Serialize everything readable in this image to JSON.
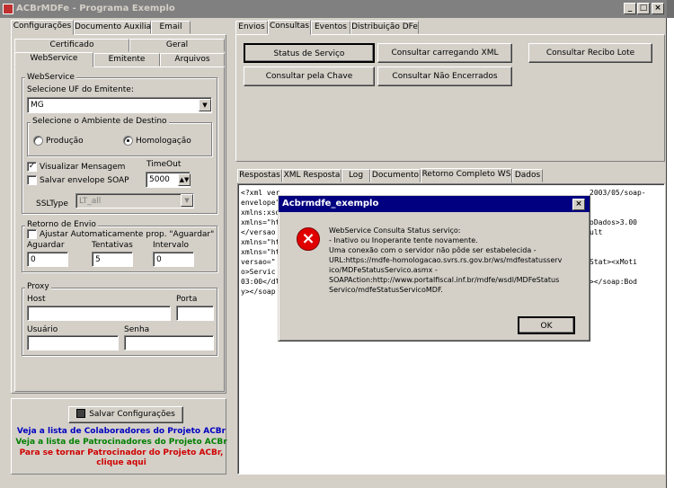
{
  "window": {
    "title": "ACBrMDFe - Programa Exemplo",
    "min_icon": "_",
    "max_icon": "□",
    "close_icon": "×"
  },
  "bg_text": {
    "left": [
      "ct",
      "ga",
      "ra",
      "Fe",
      "Fe",
      "Fe"
    ],
    "right": [
      "Ac",
      "Act",
      "roj",
      "tp",
      "Fe",
      "Fe",
      "ste"
    ]
  },
  "left_tabs": [
    "Configurações",
    "Documento Auxiliar",
    "Email"
  ],
  "sub_tabs_row1": [
    "Certificado",
    "Geral"
  ],
  "sub_tabs_row2": [
    "WebService",
    "Emitente",
    "Arquivos"
  ],
  "webservice": {
    "group_label": "WebService",
    "uf_label": "Selecione UF do Emitente:",
    "uf_value": "MG",
    "ambiente_label": "Selecione o Ambiente de Destino",
    "producao": "Produção",
    "homologacao": "Homologação",
    "visualizar": "Visualizar Mensagem",
    "visualizar_check": "✓",
    "salvar": "Salvar envelope SOAP",
    "timeout_label": "TimeOut",
    "timeout_value": "5000",
    "ssltype_label": "SSLType",
    "ssltype_value": "LT_all"
  },
  "retorno": {
    "group_label": "Retorno de Envio",
    "ajustar": "Ajustar Automaticamente prop. \"Aguardar\"",
    "aguardar_label": "Aguardar",
    "aguardar_value": "0",
    "tentativas_label": "Tentativas",
    "tentativas_value": "5",
    "intervalo_label": "Intervalo",
    "intervalo_value": "0"
  },
  "proxy": {
    "group_label": "Proxy",
    "host": "Host",
    "porta": "Porta",
    "usuario": "Usuário",
    "senha": "Senha"
  },
  "save_button": "Salvar Configurações",
  "links": {
    "colaboradores": "Veja a lista de Colaboradores do Projeto ACBr",
    "patrocinadores": "Veja a lista de Patrocinadores do Projeto ACBr",
    "patrocinador_line1": "Para se tornar Patrocinador do Projeto ACBr,",
    "patrocinador_line2": "clique aqui",
    "colors": {
      "blue": "#0000c0",
      "green": "#008000",
      "red": "#d00000"
    }
  },
  "right_tabs": [
    "Envios",
    "Consultas",
    "Eventos",
    "Distribuição DFe"
  ],
  "consultas_buttons": [
    "Status de Serviço",
    "Consultar carregando XML",
    "Consultar Recibo Lote",
    "Consultar pela Chave",
    "Consultar Não Encerrados"
  ],
  "result_tabs": [
    "Respostas",
    "XML Resposta",
    "Log",
    "Documento",
    "Retorno Completo WS",
    "Dados"
  ],
  "xml_lines": [
    "<?xml ver",
    "envelope\"",
    "xmlns:xsd",
    "xmlns=\"ht",
    "</versao",
    "xmlns=\"ht",
    "xmlns=\"ht",
    "versao=\"",
    "o>Servic",
    "03:00</dl",
    "y></soap"
  ],
  "xml_right": [
    "2003/05/soap-",
    "",
    "",
    "oDados>3.00",
    "ult",
    "",
    "",
    "Stat><xMoti",
    "",
    "></soap:Bod",
    ""
  ],
  "dialog": {
    "title": "Acbrmdfe_exemplo",
    "close_icon": "×",
    "error_icon": "×",
    "message": [
      "WebService Consulta Status serviço:",
      "- Inativo ou Inoperante tente novamente.",
      "Uma conexão com o servidor não pôde ser estabelecida -",
      "URL:https://mdfe-homologacao.svrs.rs.gov.br/ws/mdfestatusserv",
      "ico/MDFeStatusServico.asmx -",
      "SOAPAction:http://www.portalfiscal.inf.br/mdfe/wsdl/MDFeStatus",
      "Servico/mdfeStatusServicoMDF."
    ],
    "ok": "OK"
  }
}
